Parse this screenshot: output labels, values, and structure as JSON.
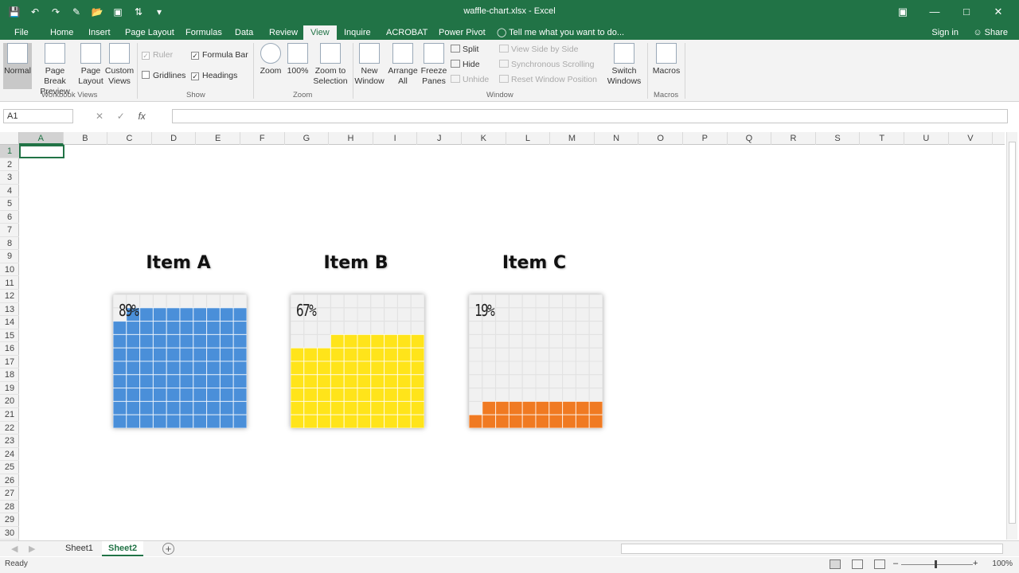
{
  "window": {
    "title": "waffle-chart.xlsx - Excel"
  },
  "qat_icons": [
    "save-icon",
    "undo-icon",
    "redo-icon",
    "format-painter-icon",
    "open-icon",
    "camera-icon",
    "sort-icon",
    "customize-qat-icon"
  ],
  "tabs": [
    "File",
    "Home",
    "Insert",
    "Page Layout",
    "Formulas",
    "Data",
    "Review",
    "View",
    "Inquire",
    "ACROBAT",
    "Power Pivot"
  ],
  "active_tab": "View",
  "tell_me": "Tell me what you want to do...",
  "account": {
    "signin": "Sign in",
    "share": "Share"
  },
  "ribbon": {
    "workbook_views": {
      "label": "Workbook Views",
      "normal": "Normal",
      "page_break_1": "Page Break",
      "page_break_2": "Preview",
      "page_layout_1": "Page",
      "page_layout_2": "Layout",
      "custom_1": "Custom",
      "custom_2": "Views"
    },
    "show": {
      "label": "Show",
      "ruler": "Ruler",
      "formula_bar": "Formula Bar",
      "gridlines": "Gridlines",
      "headings": "Headings"
    },
    "zoom": {
      "label": "Zoom",
      "zoom": "Zoom",
      "hundred": "100%",
      "zoom_sel_1": "Zoom to",
      "zoom_sel_2": "Selection"
    },
    "window": {
      "label": "Window",
      "new_1": "New",
      "new_2": "Window",
      "arrange_1": "Arrange",
      "arrange_2": "All",
      "freeze_1": "Freeze",
      "freeze_2": "Panes",
      "split": "Split",
      "hide": "Hide",
      "unhide": "Unhide",
      "side_by_side": "View Side by Side",
      "sync_scroll": "Synchronous Scrolling",
      "reset_pos": "Reset Window Position",
      "switch_1": "Switch",
      "switch_2": "Windows"
    },
    "macros": {
      "label": "Macros",
      "macros": "Macros"
    }
  },
  "formula_bar": {
    "name_box": "A1",
    "fx": "fx",
    "content": ""
  },
  "columns": [
    "A",
    "B",
    "C",
    "D",
    "E",
    "F",
    "G",
    "H",
    "I",
    "J",
    "K",
    "L",
    "M",
    "N",
    "O",
    "P",
    "Q",
    "R",
    "S",
    "T",
    "U",
    "V"
  ],
  "rows": [
    "1",
    "2",
    "3",
    "4",
    "5",
    "6",
    "7",
    "8",
    "9",
    "10",
    "11",
    "12",
    "13",
    "14",
    "15",
    "16",
    "17",
    "18",
    "19",
    "20",
    "21",
    "22",
    "23",
    "24",
    "25",
    "26",
    "27",
    "28",
    "29",
    "30"
  ],
  "charts": [
    {
      "title": "Item A",
      "percent_label": "89%",
      "value": 89,
      "color": "#4a8fd9"
    },
    {
      "title": "Item B",
      "percent_label": "67%",
      "value": 67,
      "color": "#ffe41a"
    },
    {
      "title": "Item C",
      "percent_label": "19%",
      "value": 19,
      "color": "#f07a22"
    }
  ],
  "sheets": [
    "Sheet1",
    "Sheet2"
  ],
  "active_sheet": "Sheet2",
  "status": {
    "ready": "Ready",
    "zoom": "100%"
  }
}
